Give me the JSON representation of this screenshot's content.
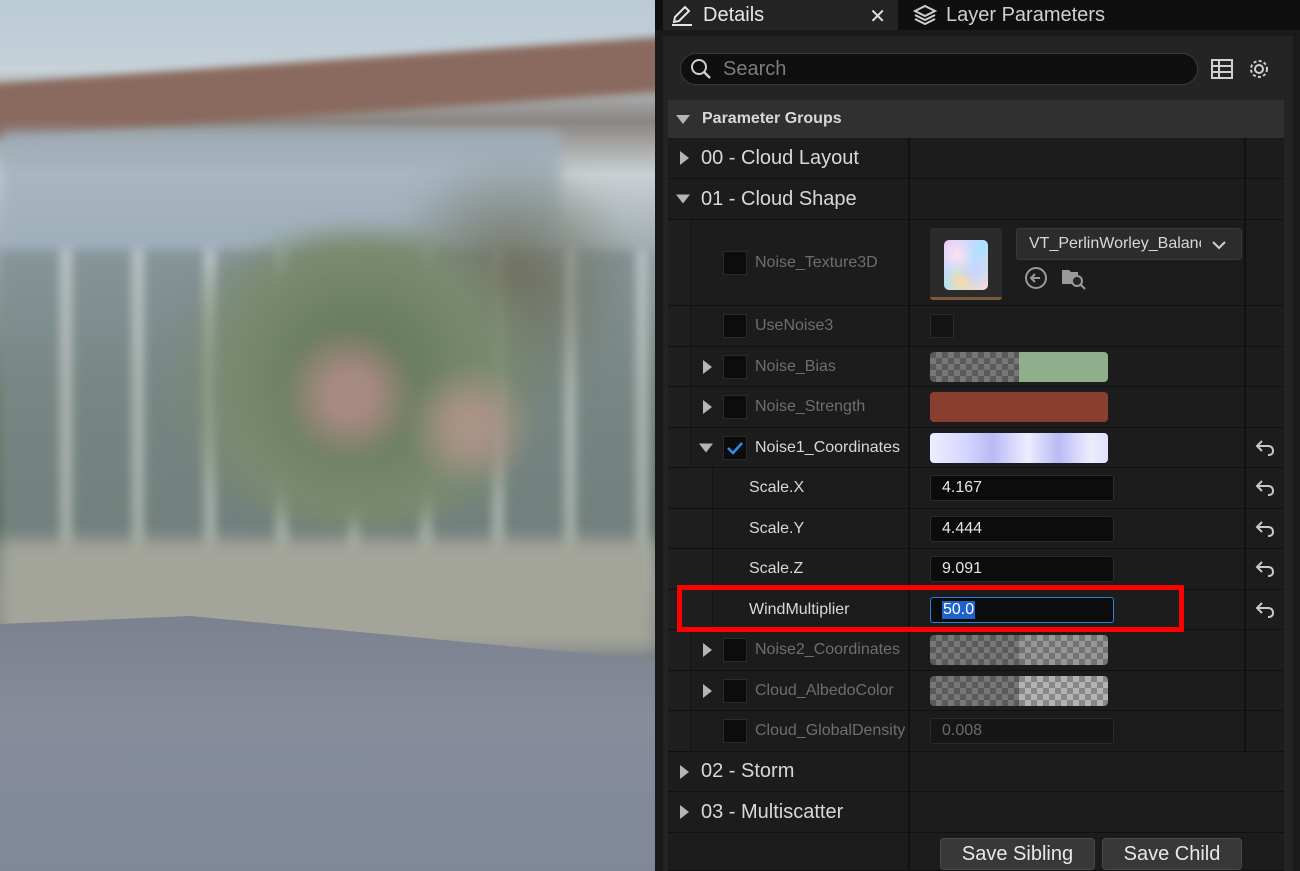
{
  "tabs": {
    "details": "Details",
    "layers": "Layer Parameters"
  },
  "search": {
    "placeholder": "Search"
  },
  "group_header": "Parameter Groups",
  "categories": {
    "cloud_layout": "00 - Cloud Layout",
    "cloud_shape": "01 - Cloud Shape",
    "storm": "02 - Storm",
    "multiscatter": "03 - Multiscatter"
  },
  "params": {
    "noise_texture": {
      "label": "Noise_Texture3D",
      "asset": "VT_PerlinWorley_Balanc"
    },
    "use_noise3": {
      "label": "UseNoise3"
    },
    "noise_bias": {
      "label": "Noise_Bias"
    },
    "noise_strength": {
      "label": "Noise_Strength",
      "color": "#8a3e30"
    },
    "noise1": {
      "label": "Noise1_Coordinates",
      "color": "#c9c8ff"
    },
    "scale_x": {
      "label": "Scale.X",
      "value": "4.167"
    },
    "scale_y": {
      "label": "Scale.Y",
      "value": "4.444"
    },
    "scale_z": {
      "label": "Scale.Z",
      "value": "9.091"
    },
    "wind": {
      "label": "WindMultiplier",
      "value": "50.0"
    },
    "noise2": {
      "label": "Noise2_Coordinates"
    },
    "albedo": {
      "label": "Cloud_AlbedoColor"
    },
    "density": {
      "label": "Cloud_GlobalDensity",
      "value": "0.008"
    }
  },
  "buttons": {
    "save_sibling": "Save Sibling",
    "save_child": "Save Child"
  },
  "colors": {
    "highlight": "#ff0000",
    "check_blue": "#2d8cf0",
    "edit_selection": "#1d63c9"
  }
}
